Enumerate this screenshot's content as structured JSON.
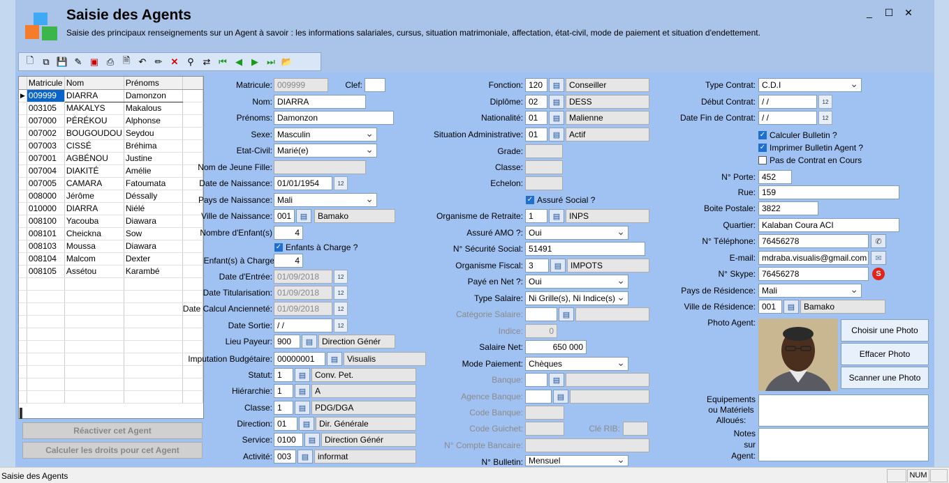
{
  "window": {
    "title": "Saisie des Agents",
    "subtitle": "Saisie des principaux renseignements sur un Agent à savoir : les informations salariales, cursus, situation matrimoniale, affectation, état-civil, mode de paiement et situation d'endettement."
  },
  "grid": {
    "headers": [
      "Matricule",
      "Nom",
      "Prénoms"
    ],
    "rows": [
      [
        "009999",
        "DIARRA",
        "Damonzon"
      ],
      [
        "003105",
        "MAKALYS",
        "Makalous"
      ],
      [
        "007000",
        "PÉRÉKOU",
        "Alphonse"
      ],
      [
        "007002",
        "BOUGOUDOU",
        "Seydou"
      ],
      [
        "007003",
        "CISSÉ",
        "Bréhima"
      ],
      [
        "007001",
        "AGBÉNOU",
        "Justine"
      ],
      [
        "007004",
        "DIAKITÉ",
        "Amélie"
      ],
      [
        "007005",
        "CAMARA",
        "Fatoumata"
      ],
      [
        "008000",
        "Jérôme",
        "Déssally"
      ],
      [
        "010000",
        "DIARRA",
        "Niélé"
      ],
      [
        "008100",
        "Yacouba",
        "Diawara"
      ],
      [
        "008101",
        "Cheickna",
        "Sow"
      ],
      [
        "008103",
        "Moussa",
        "Diawara"
      ],
      [
        "008104",
        "Malcom",
        "Dexter"
      ],
      [
        "008105",
        "Assétou",
        "Karambé"
      ]
    ]
  },
  "buttons": {
    "reactiver": "Réactiver cet Agent",
    "calculer": "Calculer les droits pour cet Agent",
    "choisir_photo": "Choisir une Photo",
    "effacer_photo": "Effacer Photo",
    "scanner_photo": "Scanner une Photo"
  },
  "col1": {
    "matricule": {
      "label": "Matricule:",
      "value": "009999"
    },
    "clef": {
      "label": "Clef:",
      "value": ""
    },
    "nom": {
      "label": "Nom:",
      "value": "DIARRA"
    },
    "prenoms": {
      "label": "Prénoms:",
      "value": "Damonzon"
    },
    "sexe": {
      "label": "Sexe:",
      "value": "Masculin"
    },
    "etat_civil": {
      "label": "Etat-Civil:",
      "value": "Marié(e)"
    },
    "nom_jeune_fille": {
      "label": "Nom de Jeune Fille:",
      "value": ""
    },
    "date_naissance": {
      "label": "Date de Naissance:",
      "value": "01/01/1954"
    },
    "pays_naissance": {
      "label": "Pays de Naissance:",
      "value": "Mali"
    },
    "ville_naissance": {
      "label": "Ville de Naissance:",
      "code": "001",
      "value": "Bamako"
    },
    "nb_enfants": {
      "label": "Nombre d'Enfant(s)",
      "value": "4"
    },
    "enfants_charge_chk": "Enfants à Charge ?",
    "enfants_charge": {
      "label": "Enfant(s) à Charge",
      "value": "4"
    },
    "date_entree": {
      "label": "Date d'Entrée:",
      "value": "01/09/2018"
    },
    "date_titularisation": {
      "label": "Date Titularisation:",
      "value": "01/09/2018"
    },
    "date_calcul": {
      "label": "Date Calcul Ancienneté:",
      "value": "01/09/2018"
    },
    "date_sortie": {
      "label": "Date Sortie:",
      "value": " / /"
    },
    "lieu_payeur": {
      "label": "Lieu Payeur:",
      "code": "900",
      "value": "Direction Génér"
    },
    "imputation": {
      "label": "Imputation Budgétaire:",
      "code": "00000001",
      "value": "Visualis"
    },
    "statut": {
      "label": "Statut:",
      "code": "1",
      "value": "Conv. Pet."
    },
    "hierarchie": {
      "label": "Hiérarchie:",
      "code": "1",
      "value": "A"
    },
    "classe": {
      "label": "Classe:",
      "code": "1",
      "value": "PDG/DGA"
    },
    "direction": {
      "label": "Direction:",
      "code": "01",
      "value": "Dir. Générale"
    },
    "service": {
      "label": "Service:",
      "code": "0100",
      "value": "Direction Génér"
    },
    "activite": {
      "label": "Activité:",
      "code": "003",
      "value": "informat"
    }
  },
  "col2": {
    "fonction": {
      "label": "Fonction:",
      "code": "120",
      "value": "Conseiller"
    },
    "diplome": {
      "label": "Diplôme:",
      "code": "02",
      "value": "DESS"
    },
    "nationalite": {
      "label": "Nationalité:",
      "code": "01",
      "value": "Malienne"
    },
    "situation_admin": {
      "label": "Situation Administrative:",
      "code": "01",
      "value": "Actif"
    },
    "grade": {
      "label": "Grade:"
    },
    "classe": {
      "label": "Classe:"
    },
    "echelon": {
      "label": "Echelon:"
    },
    "assure_social": "Assuré Social ?",
    "organisme_retraite": {
      "label": "Organisme de Retraite:",
      "code": "1",
      "value": "INPS"
    },
    "assure_amo": {
      "label": "Assuré AMO ?:",
      "value": "Oui"
    },
    "secu": {
      "label": "N° Sécurité Social:",
      "value": "51491"
    },
    "organisme_fiscal": {
      "label": "Organisme Fiscal:",
      "code": "3",
      "value": "IMPOTS"
    },
    "paye_net": {
      "label": "Payé en Net ?:",
      "value": "Oui"
    },
    "type_salaire": {
      "label": "Type Salaire:",
      "value": "Ni Grille(s), Ni Indice(s)"
    },
    "categorie_salaire": {
      "label": "Catégorie Salaire:"
    },
    "indice": {
      "label": "Indice:",
      "value": "0"
    },
    "salaire_net": {
      "label": "Salaire Net:",
      "value": "650 000"
    },
    "mode_paiement": {
      "label": "Mode Paiement:",
      "value": "Chèques"
    },
    "banque": {
      "label": "Banque:"
    },
    "agence_banque": {
      "label": "Agence Banque:"
    },
    "code_banque": {
      "label": "Code Banque:"
    },
    "code_guichet": {
      "label": "Code Guichet:"
    },
    "cle_rib": {
      "label": "Clé RIB:"
    },
    "compte": {
      "label": "N° Compte Bancaire:"
    },
    "bulletin": {
      "label": "N° Bulletin:",
      "value": "Mensuel"
    }
  },
  "col3": {
    "type_contrat": {
      "label": "Type Contrat:",
      "value": "C.D.I"
    },
    "debut_contrat": {
      "label": "Début Contrat:",
      "value": " / /"
    },
    "fin_contrat": {
      "label": "Date Fin de Contrat:",
      "value": " / /"
    },
    "chk_calc": "Calculer Bulletin ?",
    "chk_impr": "Imprimer Bulletin Agent ?",
    "chk_pas": "Pas de Contrat en Cours",
    "porte": {
      "label": "N° Porte:",
      "value": "452"
    },
    "rue": {
      "label": "Rue:",
      "value": "159"
    },
    "bp": {
      "label": "Boite Postale:",
      "value": "3822"
    },
    "quartier": {
      "label": "Quartier:",
      "value": "Kalaban Coura ACI"
    },
    "tel": {
      "label": "N° Téléphone:",
      "value": "76456278"
    },
    "email": {
      "label": "E-mail:",
      "value": "mdraba.visualis@gmail.com"
    },
    "skype": {
      "label": "N° Skype:",
      "value": "76456278"
    },
    "pays_res": {
      "label": "Pays de Résidence:",
      "value": "Mali"
    },
    "ville_res": {
      "label": "Ville de Résidence:",
      "code": "001",
      "value": "Bamako"
    },
    "photo": {
      "label": "Photo Agent:"
    },
    "equip": {
      "label1": "Equipements",
      "label2": "ou Matériels",
      "label3": "Alloués:"
    },
    "notes": {
      "label1": "Notes",
      "label2": "sur",
      "label3": "Agent:"
    }
  },
  "statusbar": {
    "text": "Saisie des Agents",
    "num": "NUM"
  }
}
